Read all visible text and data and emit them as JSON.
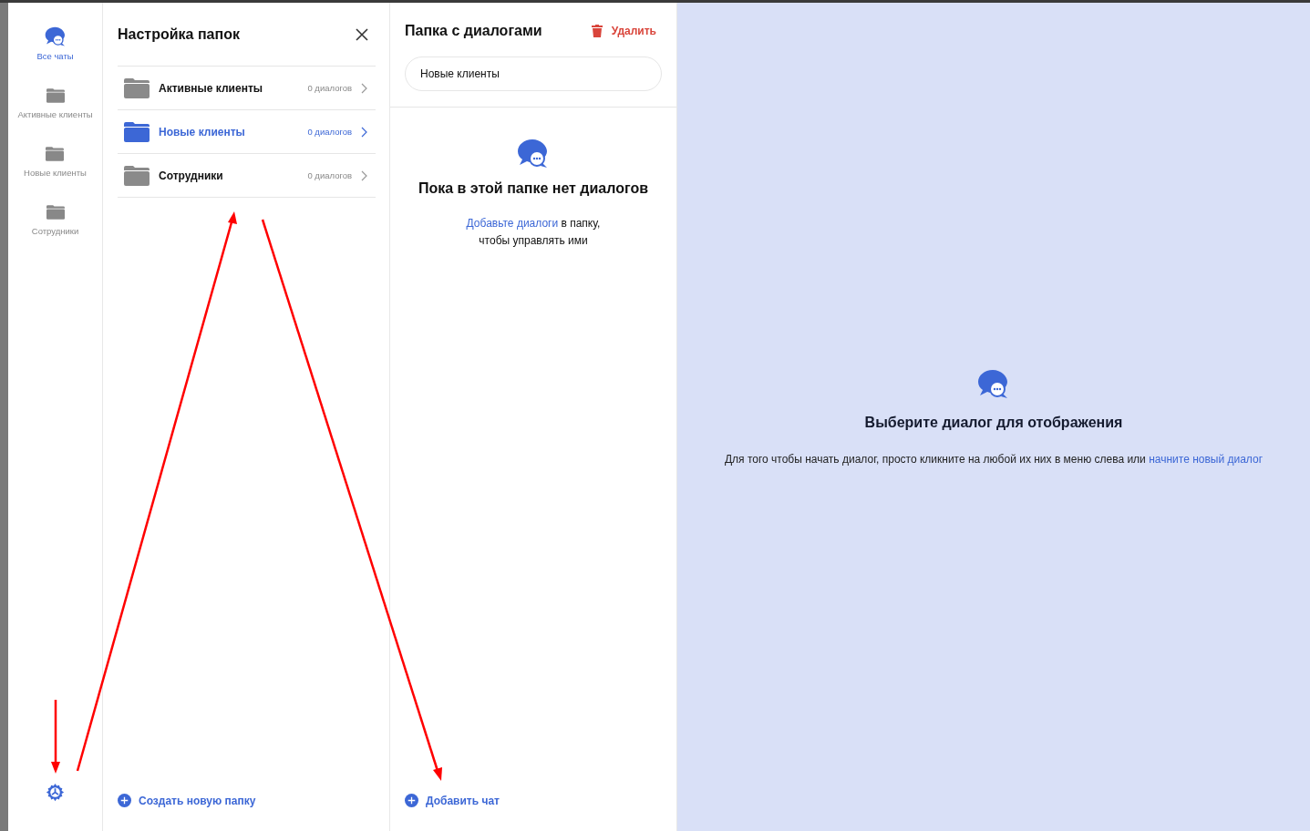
{
  "sidebar": {
    "items": [
      {
        "label": "Все чаты",
        "kind": "chats",
        "selected": true
      },
      {
        "label": "Активные клиенты",
        "kind": "folder",
        "selected": false
      },
      {
        "label": "Новые клиенты",
        "kind": "folder",
        "selected": false
      },
      {
        "label": "Сотрудники",
        "kind": "folder",
        "selected": false
      }
    ]
  },
  "folder_settings": {
    "title": "Настройка папок",
    "folders": [
      {
        "name": "Активные клиенты",
        "count": "0 диалогов",
        "selected": false
      },
      {
        "name": "Новые клиенты",
        "count": "0 диалогов",
        "selected": true
      },
      {
        "name": "Сотрудники",
        "count": "0 диалогов",
        "selected": false
      }
    ],
    "create_button": "Создать новую папку"
  },
  "folder_editor": {
    "title": "Папка с диалогами",
    "delete_button": "Удалить",
    "name_field": {
      "value": "Новые клиенты"
    },
    "empty_title": "Пока в этой папке нет диалогов",
    "empty_hint": {
      "link": "Добавьте диалоги",
      "text": "в папку, чтобы управлять ими"
    },
    "add_chat_button": "Добавить чат"
  },
  "conversation_pane": {
    "title": "Выберите диалог для отображения",
    "hint": {
      "text": "Для того чтобы начать диалог, просто кликните на любой их них в меню слева или",
      "link": "начните новый диалог"
    }
  }
}
